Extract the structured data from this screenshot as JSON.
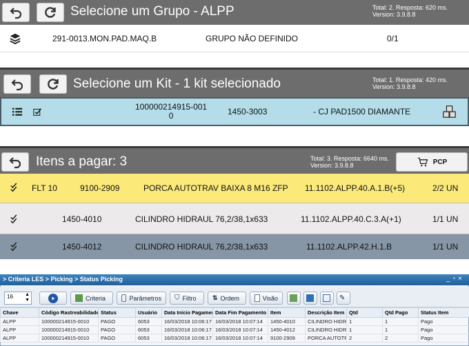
{
  "group_panel": {
    "title": "Selecione um Grupo - ALPP",
    "meta_line1": "Total: 2. Resposta: 620 ms.",
    "meta_line2": "Version: 3.9.8.8",
    "row": {
      "code": "291-0013.MON.PAD.MAQ.B",
      "group": "GRUPO NÃO DEFINIDO",
      "count": "0/1"
    }
  },
  "kit_panel": {
    "title": "Selecione um Kit - 1 kit selecionado",
    "meta_line1": "Total: 1. Resposta: 420 ms.",
    "meta_line2": "Version: 3.9.8.8",
    "row": {
      "id_line1": "100000214915-001",
      "id_line2": "0",
      "code": "1450-3003",
      "description": "- CJ PAD1500 DIAMANTE"
    }
  },
  "items_panel": {
    "title": "Itens a pagar: 3",
    "meta_line1": "Total: 3. Resposta: 6640 ms.",
    "meta_line2": "Version: 3.9.8.8",
    "pcp_label": "PCP",
    "rows": [
      {
        "loc": "FLT 10",
        "code": "9100-2909",
        "desc": "PORCA AUTOTRAV BAIXA 8 M16 ZFP",
        "item": "11.1102.ALPP.40.A.1.B(+5)",
        "qty": "2/2 UN"
      },
      {
        "loc": "",
        "code": "1450-4010",
        "desc": "CILINDRO HIDRAUL 76,2/38,1x633",
        "item": "11.1102.ALPP.40.C.3.A(+1)",
        "qty": "1/1 UN"
      },
      {
        "loc": "",
        "code": "1450-4012",
        "desc": "CILINDRO HIDRAUL 76,2/38,1x633",
        "item": "11.1102.ALPP.42.H.1.B",
        "qty": "1/1 UN"
      }
    ]
  },
  "les_window": {
    "breadcrumb": "> Criteria LES > Picking > Status Picking",
    "page_size": "16",
    "buttons": {
      "criteria": "Criteria",
      "parametros": "Parâmetros",
      "filtro": "Filtro",
      "ordem": "Ordem",
      "visao": "Visão"
    },
    "columns": [
      "Chave",
      "Código Rastreabilidade",
      "Status",
      "Usuário",
      "Data Início Pagamento",
      "Data Fim Pagamento",
      "Item",
      "Descrição Item",
      "Qtd",
      "Qtd Pago",
      "Status Item"
    ],
    "rows": [
      [
        "ALPP",
        "100000214915-0010",
        "PAGO",
        "6053",
        "16/03/2018 10:06:17",
        "16/03/2018 10:07:14",
        "1450-4010",
        "CILINDRO HIDRAI",
        "1",
        "1",
        "Pago"
      ],
      [
        "ALPP",
        "100000214915-0010",
        "PAGO",
        "6053",
        "16/03/2018 10:06:17",
        "16/03/2018 10:07:14",
        "1450-4012",
        "CILINDRO HIDRAI",
        "1",
        "1",
        "Pago"
      ],
      [
        "ALPP",
        "100000214915-0010",
        "PAGO",
        "6053",
        "16/03/2018 10:06:17",
        "16/03/2018 10:07:14",
        "9100-2909",
        "PORCA AUTOTRAV",
        "2",
        "2",
        "Pago"
      ]
    ]
  },
  "icons": {
    "back": "undo-arrow-icon",
    "refresh": "refresh-icon",
    "layers": "layers-icon",
    "list": "list-icon",
    "check": "check-icon",
    "boxes": "boxes-icon",
    "cart": "cart-icon",
    "double_check": "double-check-icon"
  },
  "colors": {
    "bar": "#6d6d6d",
    "kit_row": "#b4dde9",
    "highlight_row": "#fbe97a",
    "alt_row": "#eceaea",
    "selected_row": "#8696a6",
    "les_header": "#2d6fa8"
  }
}
